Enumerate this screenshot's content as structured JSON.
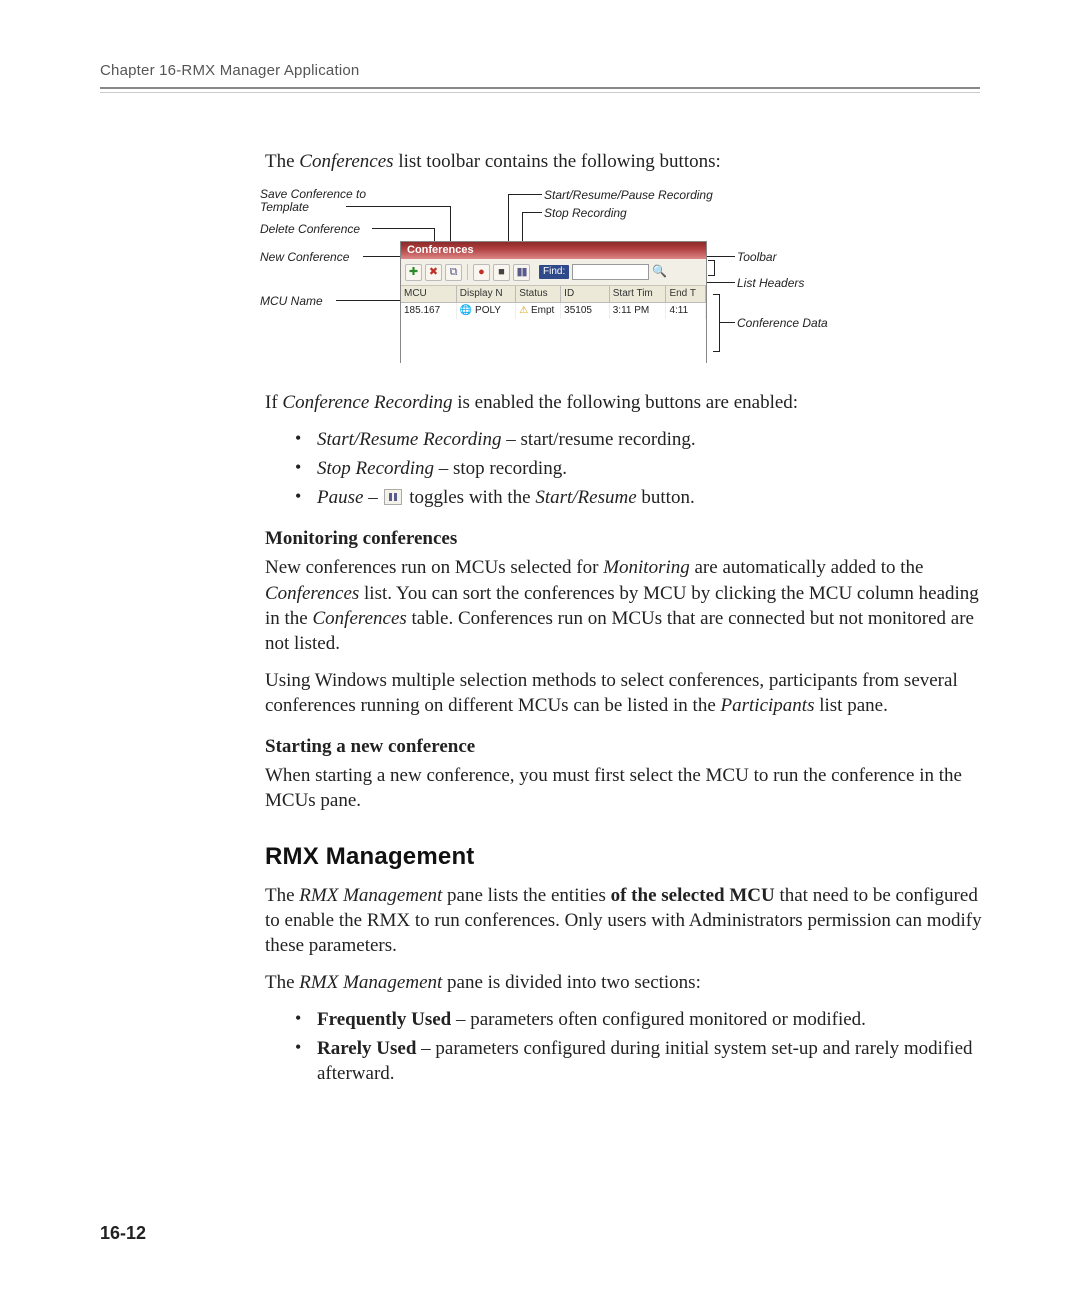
{
  "header": {
    "running": "Chapter 16-RMX Manager Application"
  },
  "page_number": "16-12",
  "intro": {
    "p1_pre": "The ",
    "p1_it": "Conferences",
    "p1_post": " list toolbar contains the following buttons:"
  },
  "figure": {
    "callouts": {
      "save_template": "Save Conference to Template",
      "delete_conf": "Delete Conference",
      "new_conf": "New Conference",
      "mcu_name": "MCU Name",
      "start_pause": "Start/Resume/Pause Recording",
      "stop_rec": "Stop Recording",
      "toolbar": "Toolbar",
      "list_headers": "List Headers",
      "conf_data": "Conference Data"
    },
    "window": {
      "title": "Conferences",
      "find_label": "Find:",
      "columns": [
        "MCU",
        "Display N",
        "Status",
        "ID",
        "Start Tim",
        "End T"
      ],
      "row": [
        "185.167",
        "POLY",
        "Empt",
        "35105",
        "3:11 PM",
        "4:11"
      ]
    }
  },
  "after_fig": {
    "p1_pre": "If ",
    "p1_it": "Conference Recording",
    "p1_post": " is enabled the following buttons are enabled:"
  },
  "rec_list": {
    "i1_it": "Start/Resume Recording",
    "i1_txt": " – start/resume recording.",
    "i2_it": "Stop Recording",
    "i2_txt": " – stop recording.",
    "i3_it1": "Pause",
    "i3_mid": " – ",
    "i3_mid2": " toggles with the ",
    "i3_it2": "Start/Resume",
    "i3_end": " button."
  },
  "monitor": {
    "head": "Monitoring conferences",
    "p1a": "New conferences run on MCUs selected for ",
    "p1it1": "Monitoring",
    "p1b": " are automatically added to the ",
    "p1it2": "Conferences",
    "p1c": " list. You can sort the conferences by MCU by clicking the MCU column heading in the ",
    "p1it3": "Conferences",
    "p1d": " table. Conferences run on MCUs that are connected but not monitored are not listed.",
    "p2a": "Using Windows multiple selection methods to select conferences, participants from several conferences running on different MCUs can be listed in the ",
    "p2it": "Participants",
    "p2b": " list pane."
  },
  "start": {
    "head": "Starting a new conference",
    "p": "When starting a new conference, you must first select the MCU to run the conference in the MCUs pane."
  },
  "mgmt": {
    "title": "RMX Management",
    "p1a": "The ",
    "p1it": "RMX Management",
    "p1b": " pane lists the entities ",
    "p1bold": "of the selected MCU",
    "p1c": " that need to be configured to enable the RMX to run conferences. Only users with Administrators permission can modify these parameters.",
    "p2a": "The ",
    "p2it": "RMX Management",
    "p2b": " pane is divided into two sections:",
    "li1_b": "Frequently Used",
    "li1_t": " – parameters often configured monitored or modified.",
    "li2_b": "Rarely Used",
    "li2_t": " – parameters configured during initial system set-up and rarely modified afterward."
  }
}
